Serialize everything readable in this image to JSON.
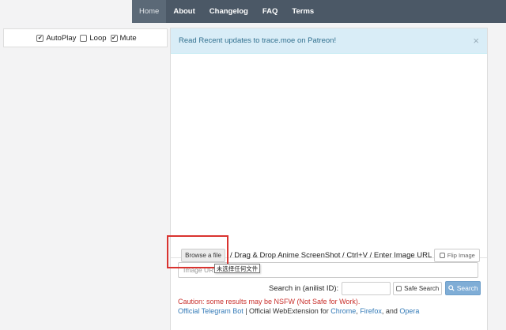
{
  "nav": {
    "items": [
      {
        "label": "Home",
        "active": true
      },
      {
        "label": "About"
      },
      {
        "label": "Changelog"
      },
      {
        "label": "FAQ"
      },
      {
        "label": "Terms"
      }
    ]
  },
  "options": {
    "autoplay_label": "AutoPlay",
    "loop_label": "Loop",
    "mute_label": "Mute",
    "autoplay_checked": true,
    "loop_checked": false,
    "mute_checked": true
  },
  "alert": {
    "text": "Read Recent updates to trace.moe on Patreon!",
    "close": "×"
  },
  "upload": {
    "browse_label": "Browse a file",
    "drag_text": "/ Drag & Drop Anime ScreenShot / Ctrl+V / Enter Image URL",
    "flip_label": "Flip Image",
    "tooltip": "未选择任何文件",
    "url_placeholder": "Image URL"
  },
  "search": {
    "label": "Search in (anilist ID):",
    "safe_label": "Safe Search",
    "button_label": "Search",
    "search_icon": "magnifier-icon"
  },
  "notices": {
    "caution": "Caution: some results may be NSFW (Not Safe for Work).",
    "telegram": "Official Telegram Bot",
    "sep": " | Official WebExtension for ",
    "chrome": "Chrome",
    "comma": ", ",
    "firefox": "Firefox",
    "and": ", and ",
    "opera": "Opera"
  },
  "colors": {
    "navbar": "#4b5866",
    "alert_bg": "#d9edf7",
    "alert_text": "#31708f",
    "caution": "#c9302c",
    "link": "#337ab7",
    "highlight": "#d9332f"
  }
}
